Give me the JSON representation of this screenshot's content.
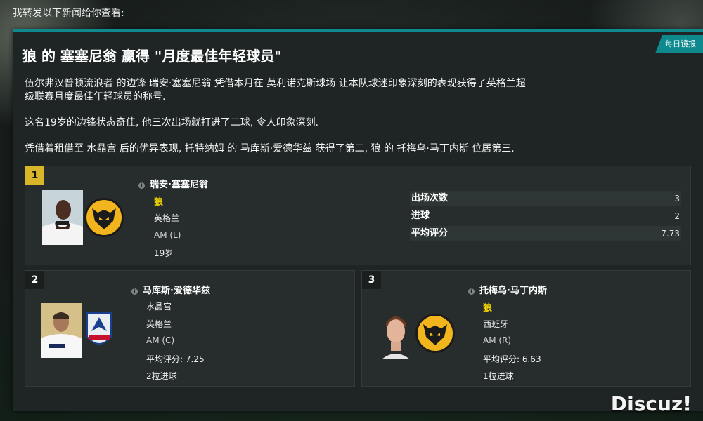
{
  "intro": "我转发以下新闻给你查看:",
  "badge": "每日镜报",
  "headline": "狼 的 塞塞尼翁 赢得 \"月度最佳年轻球员\"",
  "paragraphs": [
    "伍尔弗汉普顿流浪者 的边锋 瑞安·塞塞尼翁 凭借本月在 莫利诺克斯球场 让本队球迷印象深刻的表现获得了英格兰超级联赛月度最佳年轻球员的称号.",
    "这名19岁的边锋状态奇佳, 他三次出场就打进了二球, 令人印象深刻.",
    "凭借着租借至 水晶宫 后的优异表现, 托特纳姆 的 马库斯·爱德华兹 获得了第二, 狼 的 托梅乌·马丁内斯 位居第三."
  ],
  "winner": {
    "rank": "1",
    "name": "瑞安·塞塞尼翁",
    "club": "狼",
    "nation": "英格兰",
    "position": "AM (L)",
    "age": "19岁",
    "stats": [
      {
        "label": "出场次数",
        "value": "3"
      },
      {
        "label": "进球",
        "value": "2"
      },
      {
        "label": "平均评分",
        "value": "7.73"
      }
    ]
  },
  "second": {
    "rank": "2",
    "name": "马库斯·爱德华兹",
    "club": "水晶宫",
    "nation": "英格兰",
    "position": "AM (C)",
    "rating": "平均评分: 7.25",
    "goals": "2粒进球"
  },
  "third": {
    "rank": "3",
    "name": "托梅乌·马丁内斯",
    "club": "狼",
    "nation": "西班牙",
    "position": "AM (R)",
    "rating": "平均评分: 6.63",
    "goals": "1粒进球"
  },
  "watermark": "Discuz!",
  "colors": {
    "accent": "#0e8a8f",
    "gold": "#d9b628",
    "club_highlight": "#f1d400"
  },
  "icons": [
    "info-icon",
    "wolves-crest-icon",
    "crystal-palace-crest-icon"
  ]
}
